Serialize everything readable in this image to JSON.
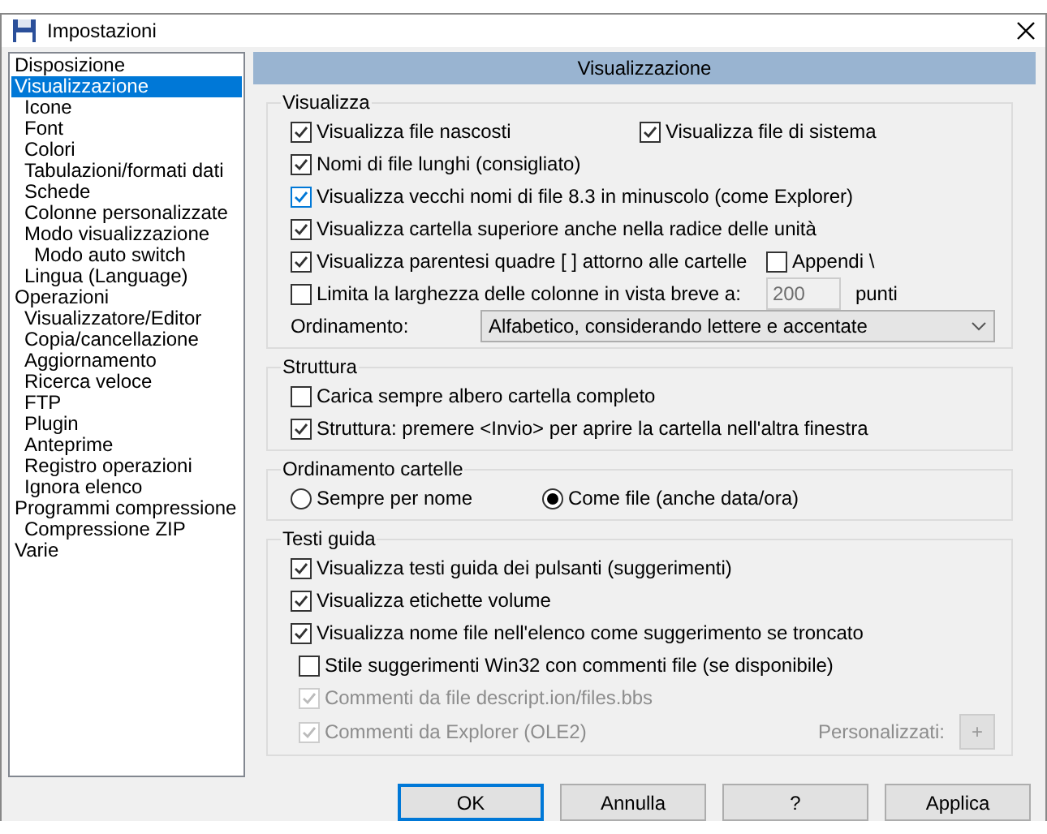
{
  "window": {
    "title": "Impostazioni"
  },
  "tree": [
    {
      "label": "Disposizione",
      "selected": false
    },
    {
      "label": "Visualizzazione",
      "selected": true,
      "children": [
        {
          "label": "Icone",
          "selected": false
        },
        {
          "label": "Font",
          "selected": false
        },
        {
          "label": "Colori",
          "selected": false
        },
        {
          "label": "Tabulazioni/formati dati",
          "selected": false
        },
        {
          "label": "Schede",
          "selected": false
        },
        {
          "label": "Colonne personalizzate",
          "selected": false
        },
        {
          "label": "Modo visualizzazione",
          "selected": false,
          "children": [
            {
              "label": "Modo auto switch",
              "selected": false
            }
          ]
        },
        {
          "label": "Lingua (Language)",
          "selected": false
        }
      ]
    },
    {
      "label": "Operazioni",
      "selected": false,
      "children": [
        {
          "label": "Visualizzatore/Editor",
          "selected": false
        },
        {
          "label": "Copia/cancellazione",
          "selected": false
        },
        {
          "label": "Aggiornamento",
          "selected": false
        },
        {
          "label": "Ricerca veloce",
          "selected": false
        },
        {
          "label": "FTP",
          "selected": false
        },
        {
          "label": "Plugin",
          "selected": false
        },
        {
          "label": "Anteprime",
          "selected": false
        },
        {
          "label": "Registro operazioni",
          "selected": false
        },
        {
          "label": "Ignora elenco",
          "selected": false
        }
      ]
    },
    {
      "label": "Programmi compressione",
      "selected": false,
      "children": [
        {
          "label": "Compressione ZIP",
          "selected": false
        }
      ]
    },
    {
      "label": "Varie",
      "selected": false
    }
  ],
  "panel": {
    "title": "Visualizzazione",
    "sections": [
      {
        "title": "Visualizza",
        "rows": [
          {
            "items": [
              {
                "kind": "checkbox",
                "label": "Visualizza file nascosti",
                "checked": true,
                "disabled": false
              },
              {
                "kind": "checkbox",
                "label": "Visualizza file di sistema",
                "checked": true,
                "disabled": false
              }
            ]
          },
          {
            "items": [
              {
                "kind": "checkbox",
                "label": "Nomi di file lunghi (consigliato)",
                "checked": true,
                "disabled": false
              }
            ]
          },
          {
            "items": [
              {
                "kind": "checkbox",
                "label": "Visualizza vecchi nomi di file 8.3 in minuscolo (come Explorer)",
                "checked": true,
                "disabled": false
              }
            ]
          },
          {
            "items": [
              {
                "kind": "checkbox",
                "label": "Visualizza cartella superiore anche nella radice delle unità",
                "checked": true,
                "disabled": false
              }
            ]
          },
          {
            "items": [
              {
                "kind": "checkbox",
                "label": "Visualizza parentesi quadre [ ] attorno alle cartelle",
                "checked": true,
                "disabled": false
              },
              {
                "kind": "checkbox",
                "label": "Appendi \\",
                "checked": false,
                "disabled": false
              }
            ]
          },
          {
            "items": [
              {
                "kind": "checkbox",
                "label": "Limita la larghezza delle colonne in vista breve a:",
                "checked": false,
                "disabled": false
              },
              {
                "kind": "field",
                "value": "200",
                "disabled": true
              },
              {
                "kind": "text",
                "label": "punti"
              }
            ]
          },
          {
            "items": [
              {
                "kind": "text",
                "label": "Ordinamento:"
              },
              {
                "kind": "select",
                "value": "Alfabetico, considerando lettere e accentate"
              }
            ]
          }
        ]
      },
      {
        "title": "Struttura",
        "rows": [
          {
            "items": [
              {
                "kind": "checkbox",
                "label": "Carica sempre albero cartella completo",
                "checked": false,
                "disabled": false
              }
            ]
          },
          {
            "items": [
              {
                "kind": "checkbox",
                "label": "Struttura: premere <Invio> per aprire la cartella nell'altra finestra",
                "checked": true,
                "disabled": false
              }
            ]
          }
        ]
      },
      {
        "title": "Ordinamento cartelle",
        "rows": [
          {
            "items": [
              {
                "kind": "radio",
                "label": "Sempre per nome",
                "selected": false
              },
              {
                "kind": "radio",
                "label": "Come file (anche data/ora)",
                "selected": true
              }
            ]
          }
        ]
      },
      {
        "title": "Testi guida",
        "rows": [
          {
            "items": [
              {
                "kind": "checkbox",
                "label": "Visualizza testi guida dei pulsanti (suggerimenti)",
                "checked": true,
                "disabled": false
              }
            ]
          },
          {
            "items": [
              {
                "kind": "checkbox",
                "label": "Visualizza etichette volume",
                "checked": true,
                "disabled": false
              }
            ]
          },
          {
            "items": [
              {
                "kind": "checkbox",
                "label": "Visualizza nome file nell'elenco come suggerimento se troncato",
                "checked": true,
                "disabled": false
              }
            ],
            "children": [
              {
                "items": [
                  {
                    "kind": "checkbox",
                    "label": "Stile suggerimenti Win32 con commenti file (se disponibile)",
                    "checked": false,
                    "disabled": false
                  }
                ]
              },
              {
                "items": [
                  {
                    "kind": "checkbox",
                    "label": "Commenti da file descript.ion/files.bbs",
                    "checked": true,
                    "disabled": true
                  }
                ]
              },
              {
                "items": [
                  {
                    "kind": "checkbox",
                    "label": "Commenti da Explorer (OLE2)",
                    "checked": true,
                    "disabled": true
                  },
                  {
                    "kind": "custom",
                    "label": "Personalizzati:",
                    "button": "+",
                    "disabled": true
                  }
                ]
              }
            ]
          }
        ]
      }
    ]
  },
  "buttons": [
    {
      "label": "OK",
      "default": true
    },
    {
      "label": "Annulla",
      "default": false
    },
    {
      "label": "?",
      "default": false
    },
    {
      "label": "Applica",
      "default": false
    }
  ]
}
